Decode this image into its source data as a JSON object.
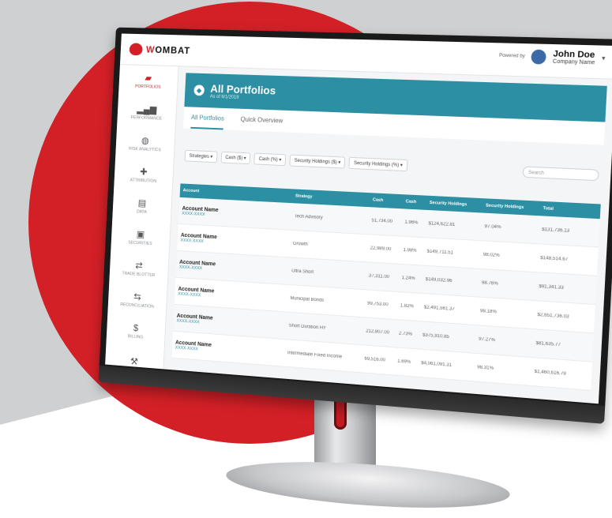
{
  "brand": {
    "logo_prefix": "W",
    "logo_rest": "OMBAT",
    "accent": "#d31f26",
    "teal": "#2c8fa3"
  },
  "topbar": {
    "powered_by": "Powered by",
    "user_name": "John Doe",
    "company": "Company Name"
  },
  "sidebar": {
    "items": [
      {
        "label": "Portfolios",
        "icon": "briefcase-icon",
        "glyph": "▰"
      },
      {
        "label": "Performance",
        "icon": "bar-chart-icon",
        "glyph": "▂▄▆"
      },
      {
        "label": "Risk Analytics",
        "icon": "globe-icon",
        "glyph": "◍"
      },
      {
        "label": "Attribution",
        "icon": "tools-icon",
        "glyph": "✚"
      },
      {
        "label": "Data",
        "icon": "database-icon",
        "glyph": "▤"
      },
      {
        "label": "Securities",
        "icon": "lock-icon",
        "glyph": "▣"
      },
      {
        "label": "Trade Blotter",
        "icon": "transfer-icon",
        "glyph": "⇄"
      },
      {
        "label": "Reconciliation",
        "icon": "reconcile-icon",
        "glyph": "⇆"
      },
      {
        "label": "Billing",
        "icon": "dollar-icon",
        "glyph": "$"
      },
      {
        "label": "",
        "icon": "wrench-icon",
        "glyph": "⚒"
      }
    ]
  },
  "header": {
    "title": "All Portfolios",
    "subtitle": "As of 6/1/2019"
  },
  "tabs": [
    "All Portfolios",
    "Quick Overview"
  ],
  "filters": [
    "Strategies ▾",
    "Cash ($) ▾",
    "Cash (%) ▾",
    "Security Holdings ($) ▾",
    "Security Holdings (%) ▾"
  ],
  "search": {
    "placeholder": "Search"
  },
  "table": {
    "columns": [
      "Account",
      "Strategy",
      "Cash",
      "Cash",
      "Security Holdings",
      "Security Holdings",
      "Total"
    ],
    "rows": [
      {
        "name": "Account Name",
        "number": "XXXX-XXXX",
        "strategy": "Tech Advisory",
        "cash": "51,734.00",
        "cash_pct": "1.96%",
        "sec": "$124,622.81",
        "sec_pct": "97.04%",
        "total": "$131,736.13"
      },
      {
        "name": "Account Name",
        "number": "XXXX-XXXX",
        "strategy": "Growth",
        "cash": "22,989.00",
        "cash_pct": "1.98%",
        "sec": "$149,711.51",
        "sec_pct": "98.02%",
        "total": "$148,514.67"
      },
      {
        "name": "Account Name",
        "number": "XXXX-XXXX",
        "strategy": "Ultra Short",
        "cash": "37,311.00",
        "cash_pct": "1.24%",
        "sec": "$149,032.96",
        "sec_pct": "98.76%",
        "total": "$91,341.33"
      },
      {
        "name": "Account Name",
        "number": "XXXX-XXXX",
        "strategy": "Municipal Bonds",
        "cash": "99,753.00",
        "cash_pct": "1.82%",
        "sec": "$2,491,561.37",
        "sec_pct": "98.18%",
        "total": "$2,651,736.03"
      },
      {
        "name": "Account Name",
        "number": "XXXX-XXXX",
        "strategy": "Short Duration HY",
        "cash": "212,807.00",
        "cash_pct": "2.73%",
        "sec": "$375,910.85",
        "sec_pct": "97.27%",
        "total": "$81,635.77"
      },
      {
        "name": "Account Name",
        "number": "XXXX-XXXX",
        "strategy": "Intermediate Fixed Income",
        "cash": "69,516.00",
        "cash_pct": "1.69%",
        "sec": "$4,061,091.31",
        "sec_pct": "98.31%",
        "total": "$1,460,616.79"
      }
    ]
  }
}
